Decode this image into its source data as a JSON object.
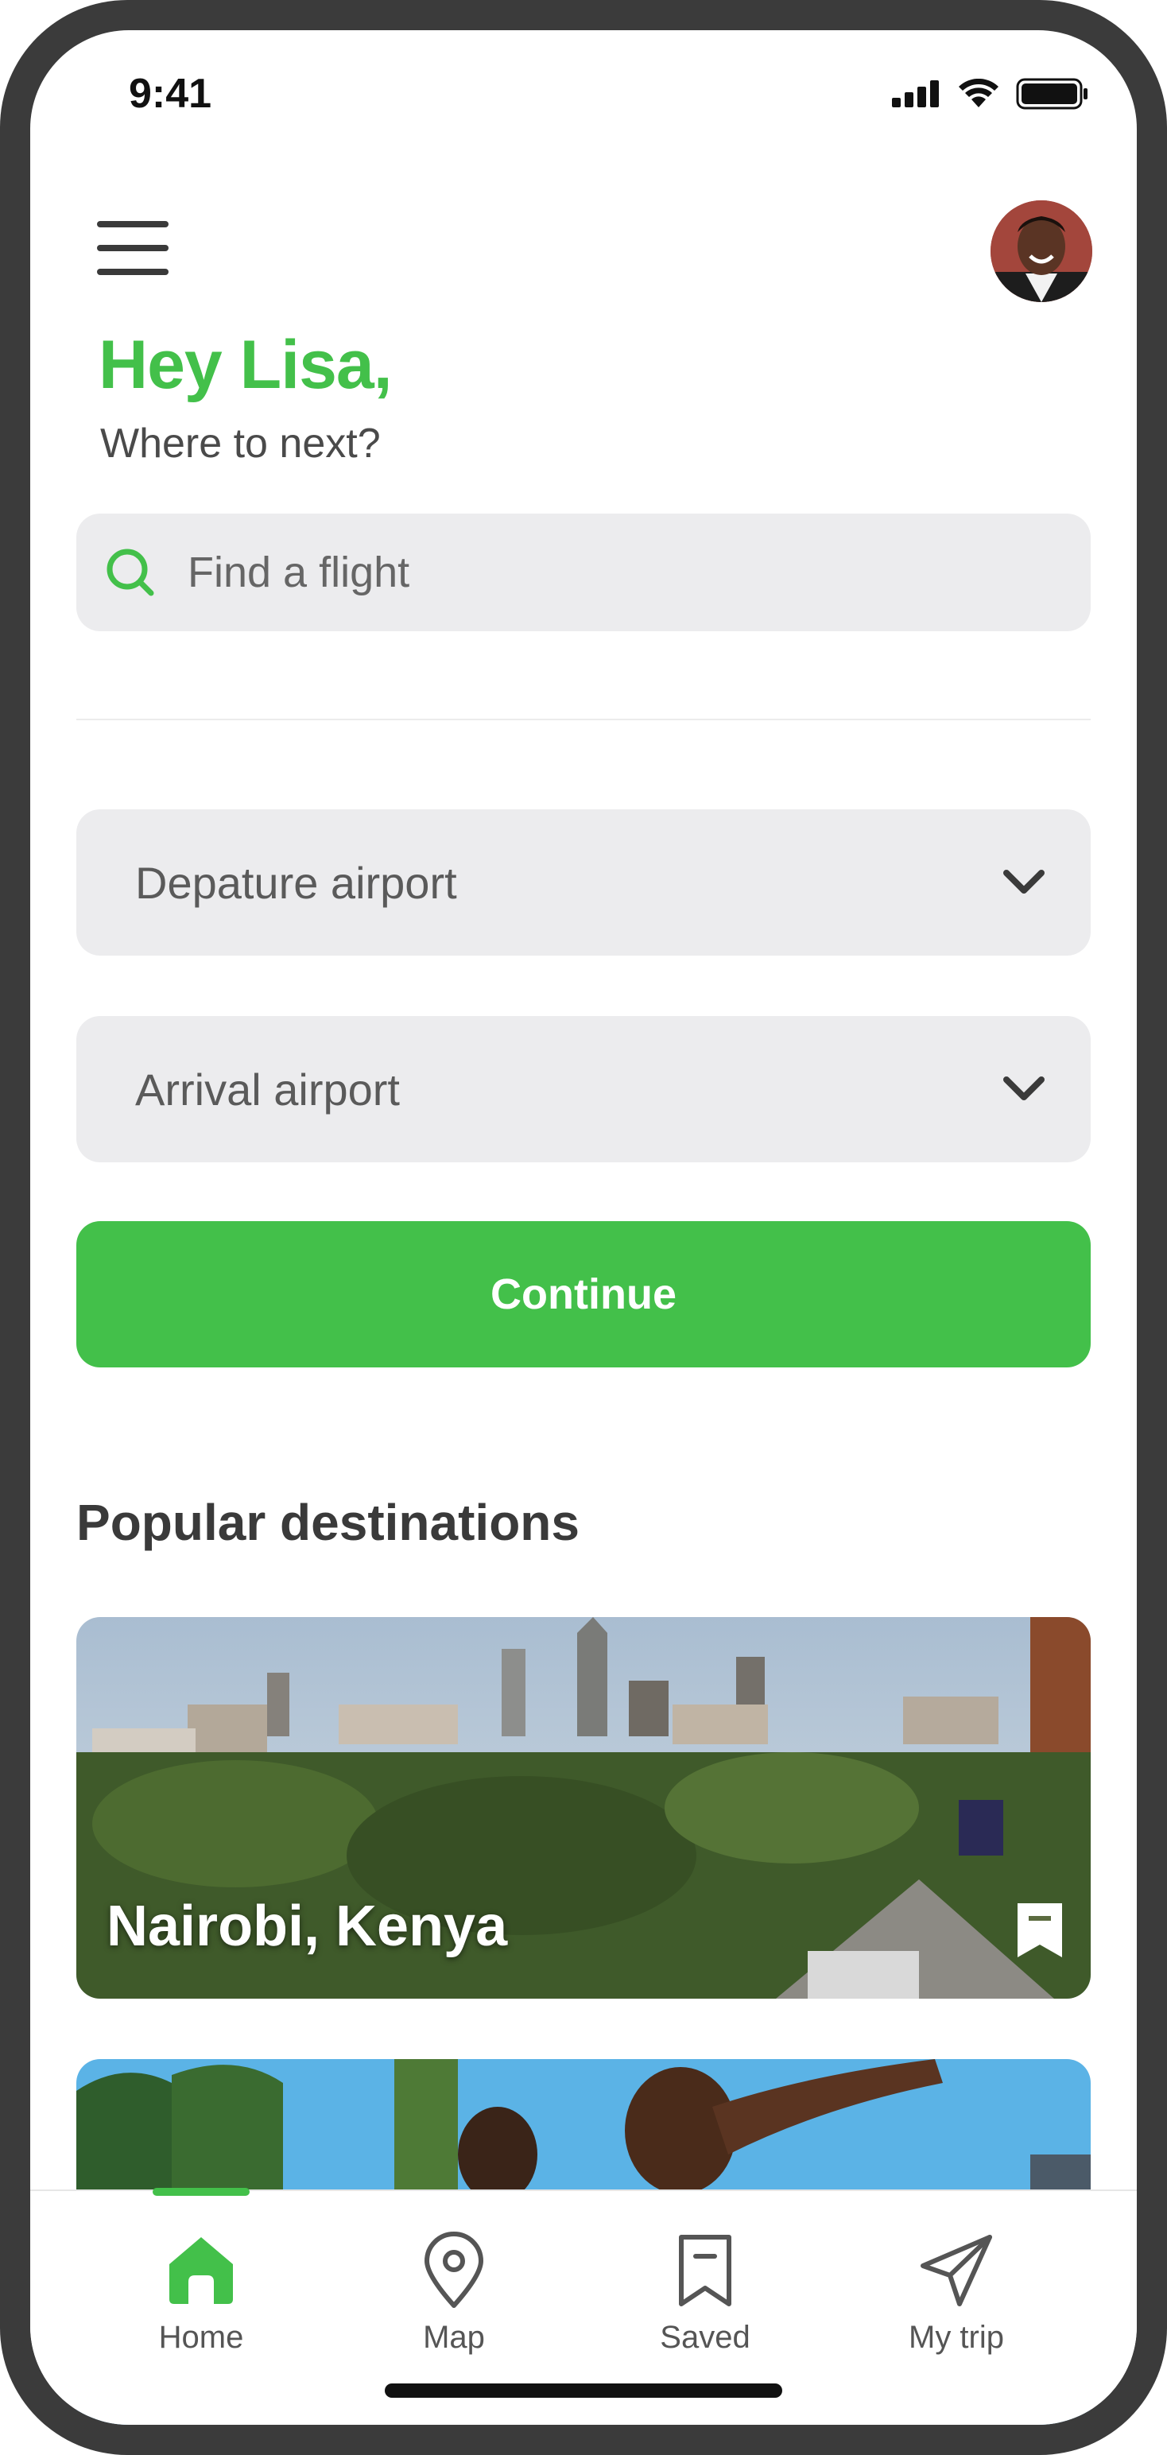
{
  "status_bar": {
    "time": "9:41"
  },
  "header": {
    "greeting": "Hey Lisa,",
    "subtitle": "Where to next?"
  },
  "search": {
    "placeholder": "Find a flight"
  },
  "form": {
    "departure_label": "Depature airport",
    "arrival_label": "Arrival airport",
    "continue_label": "Continue"
  },
  "popular": {
    "title": "Popular destinations",
    "cards": [
      {
        "title": "Nairobi, Kenya"
      }
    ]
  },
  "nav": {
    "items": [
      {
        "label": "Home",
        "icon": "home-icon",
        "active": true
      },
      {
        "label": "Map",
        "icon": "map-pin-icon",
        "active": false
      },
      {
        "label": "Saved",
        "icon": "bookmark-icon",
        "active": false
      },
      {
        "label": "My trip",
        "icon": "paper-plane-icon",
        "active": false
      }
    ]
  },
  "colors": {
    "accent": "#43c04a",
    "field_bg": "#ececee",
    "text_dark": "#3a3a3a",
    "frame": "#3b3b3b"
  }
}
